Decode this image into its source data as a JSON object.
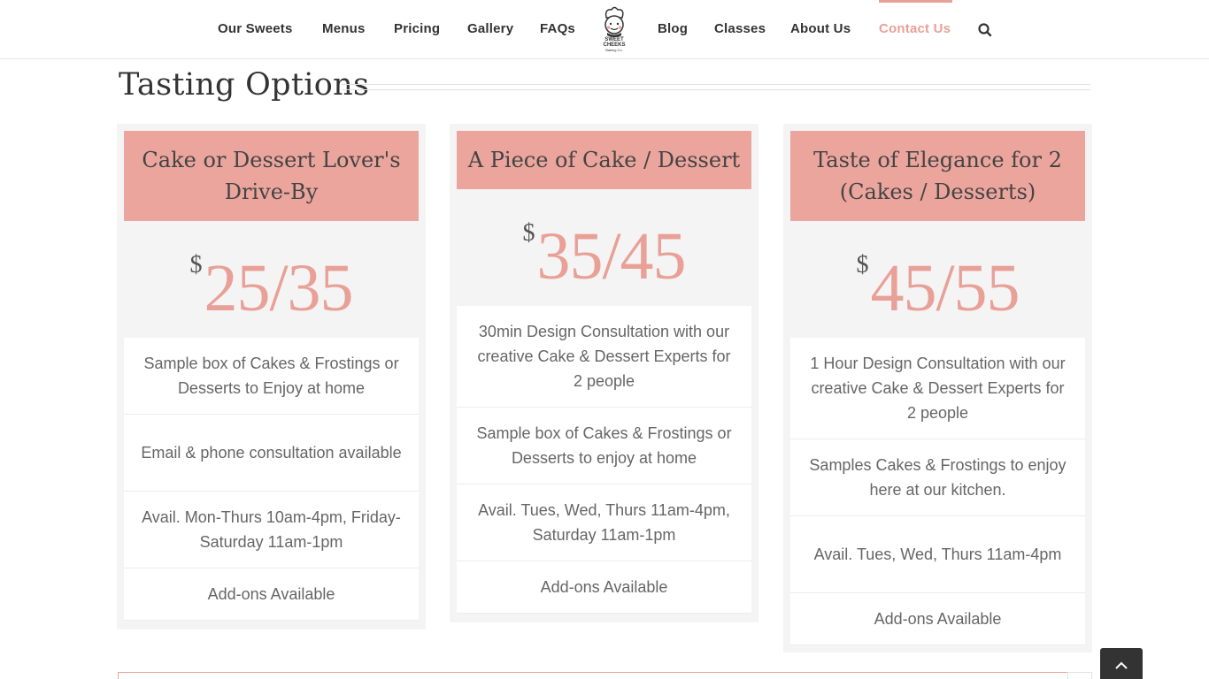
{
  "nav": {
    "items": [
      {
        "label": "Our Sweets"
      },
      {
        "label": "Menus"
      },
      {
        "label": "Pricing"
      },
      {
        "label": "Gallery"
      },
      {
        "label": "FAQs"
      },
      {
        "label": "Blog"
      },
      {
        "label": "Classes"
      },
      {
        "label": "About Us"
      },
      {
        "label": "Contact Us",
        "active": true
      }
    ],
    "logo_text": [
      "SWEET",
      "CHEEKS",
      "Baking Co."
    ],
    "search_icon": "search-icon"
  },
  "section": {
    "title": "Tasting Options"
  },
  "cards": [
    {
      "title": "Cake or Dessert Lover's Drive-By",
      "currency": "$",
      "price": "25/35",
      "features": [
        "Sample box of Cakes & Frostings or Desserts to Enjoy at home",
        "Email & phone consultation available",
        "Avail. Mon-Thurs 10am-4pm, Friday-Saturday 11am-1pm",
        "Add-ons Available"
      ]
    },
    {
      "title": "A Piece of Cake / Dessert",
      "currency": "$",
      "price": "35/45",
      "features": [
        "30min Design Consultation with our creative Cake & Dessert Experts for 2 people",
        "Sample box of Cakes & Frostings or Desserts to enjoy at home",
        "Avail. Tues, Wed, Thurs 11am-4pm, Saturday 11am-1pm",
        "Add-ons Available"
      ]
    },
    {
      "title": "Taste of Elegance for 2 (Cakes / Desserts)",
      "currency": "$",
      "price": "45/55",
      "features": [
        "1 Hour Design Consultation with our creative Cake & Dessert Experts for 2 people",
        "Samples Cakes & Frostings to enjoy here at our kitchen.",
        "Avail. Tues, Wed, Thurs 11am-4pm",
        "Add-ons Available"
      ]
    }
  ],
  "colors": {
    "accent": "#e8a097",
    "card_header": "#eba59d",
    "card_bg": "#f4f4f4"
  },
  "icons": {
    "scroll_top": "chevron-up-icon"
  }
}
